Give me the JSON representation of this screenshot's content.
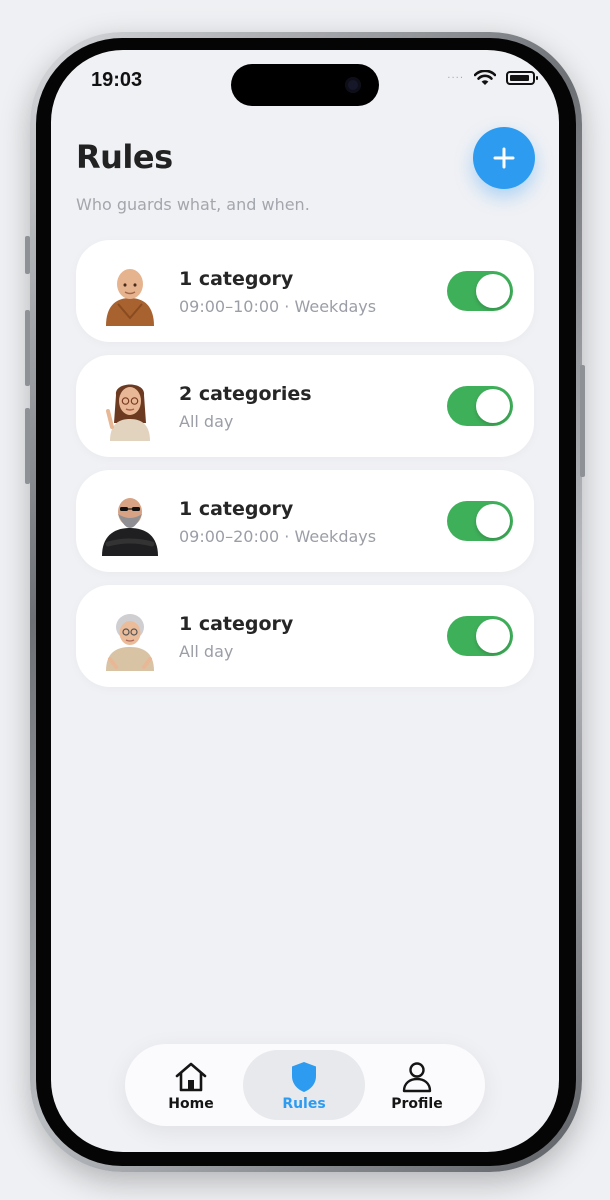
{
  "status_bar": {
    "time": "19:03",
    "signal_text": "····",
    "icons": [
      "signal-dots-icon",
      "wifi-icon",
      "battery-icon"
    ]
  },
  "header": {
    "title": "Rules",
    "subtitle": "Who guards what, and when.",
    "add_button_icon": "plus-icon"
  },
  "rules": [
    {
      "avatar": "monk-avatar",
      "title": "1 category",
      "subtitle": "09:00–10:00 · Weekdays",
      "enabled": true
    },
    {
      "avatar": "woman-pointing-avatar",
      "title": "2 categories",
      "subtitle": "All day",
      "enabled": true
    },
    {
      "avatar": "bearded-man-avatar",
      "title": "1 category",
      "subtitle": "09:00–20:00 · Weekdays",
      "enabled": true
    },
    {
      "avatar": "grandma-avatar",
      "title": "1 category",
      "subtitle": "All day",
      "enabled": true
    }
  ],
  "nav": {
    "items": [
      {
        "label": "Home",
        "icon": "home-icon",
        "active": false
      },
      {
        "label": "Rules",
        "icon": "shield-icon",
        "active": true
      },
      {
        "label": "Profile",
        "icon": "person-icon",
        "active": false
      }
    ]
  },
  "colors": {
    "accent": "#2d9cf0",
    "toggle_on": "#3fb05a",
    "background": "#f0f1f5",
    "card": "#ffffff"
  }
}
